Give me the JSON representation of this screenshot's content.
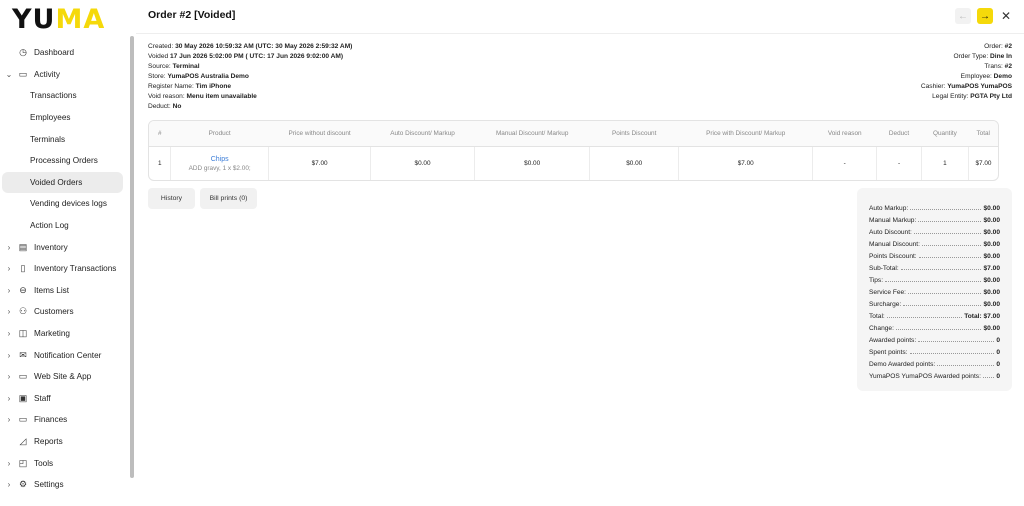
{
  "logo": {
    "main": "YU",
    "accent": "MA"
  },
  "sidebar": {
    "items": [
      {
        "label": "Dashboard",
        "icon": "dashboard-icon",
        "glyph": "◷",
        "chevron": "",
        "type": "top"
      },
      {
        "label": "Activity",
        "icon": "activity-icon",
        "glyph": "▭",
        "chevron": "⌄",
        "type": "top"
      },
      {
        "label": "Transactions",
        "type": "sub"
      },
      {
        "label": "Employees",
        "type": "sub"
      },
      {
        "label": "Terminals",
        "type": "sub"
      },
      {
        "label": "Processing Orders",
        "type": "sub"
      },
      {
        "label": "Voided Orders",
        "type": "sub-active"
      },
      {
        "label": "Vending devices logs",
        "type": "sub"
      },
      {
        "label": "Action Log",
        "type": "sub"
      },
      {
        "label": "Inventory",
        "icon": "inventory-icon",
        "glyph": "▤",
        "chevron": "›",
        "type": "top"
      },
      {
        "label": "Inventory Transactions",
        "icon": "inventory-transactions-icon",
        "glyph": "▯",
        "chevron": "›",
        "type": "top"
      },
      {
        "label": "Items List",
        "icon": "items-list-icon",
        "glyph": "⊖",
        "chevron": "›",
        "type": "top"
      },
      {
        "label": "Customers",
        "icon": "customers-icon",
        "glyph": "⚇",
        "chevron": "›",
        "type": "top"
      },
      {
        "label": "Marketing",
        "icon": "marketing-icon",
        "glyph": "◫",
        "chevron": "›",
        "type": "top"
      },
      {
        "label": "Notification Center",
        "icon": "notification-icon",
        "glyph": "✉",
        "chevron": "›",
        "type": "top"
      },
      {
        "label": "Web Site & App",
        "icon": "website-icon",
        "glyph": "▭",
        "chevron": "›",
        "type": "top"
      },
      {
        "label": "Staff",
        "icon": "staff-icon",
        "glyph": "▣",
        "chevron": "›",
        "type": "top"
      },
      {
        "label": "Finances",
        "icon": "finances-icon",
        "glyph": "▭",
        "chevron": "›",
        "type": "top"
      },
      {
        "label": "Reports",
        "icon": "reports-icon",
        "glyph": "◿",
        "chevron": "",
        "type": "top"
      },
      {
        "label": "Tools",
        "icon": "tools-icon",
        "glyph": "◰",
        "chevron": "›",
        "type": "top"
      },
      {
        "label": "Settings",
        "icon": "settings-icon",
        "glyph": "⚙",
        "chevron": "›",
        "type": "top"
      }
    ]
  },
  "header": {
    "title": "Order #2 [Voided]",
    "prev_glyph": "←",
    "next_glyph": "→",
    "close_glyph": "✕"
  },
  "info_left": [
    {
      "label": "Created: ",
      "value": "30 May 2026 10:59:32 AM (UTC: 30 May 2026 2:59:32 AM)"
    },
    {
      "label": "Voided ",
      "value": "17 Jun 2026 5:02:00 PM ( UTC: 17 Jun 2026 9:02:00 AM)"
    },
    {
      "label": "Source: ",
      "value": "Terminal"
    },
    {
      "label": "Store: ",
      "value": "YumaPOS Australia Demo"
    },
    {
      "label": "Register Name: ",
      "value": "Tim iPhone"
    },
    {
      "label": "Void reason: ",
      "value": "Menu item unavailable"
    },
    {
      "label": "Deduct: ",
      "value": "No"
    }
  ],
  "info_right": [
    {
      "label": "Order: ",
      "value": "#2"
    },
    {
      "label": "Order Type: ",
      "value": "Dine In"
    },
    {
      "label": "Trans: ",
      "value": "#2"
    },
    {
      "label": "Employee: ",
      "value": "Demo"
    },
    {
      "label": "Cashier: ",
      "value": "YumaPOS YumaPOS"
    },
    {
      "label": "Legal Entity: ",
      "value": "PGTA Pty Ltd"
    }
  ],
  "table": {
    "headers": [
      "#",
      "Product",
      "Price without discount",
      "Auto Discount/ Markup",
      "Manual Discount/ Markup",
      "Points Discount",
      "Price with Discount/ Markup",
      "Void reason",
      "Deduct",
      "Quantity",
      "Total"
    ],
    "rows": [
      {
        "num": "1",
        "product": "Chips",
        "product_sub": "ADD gravy, 1 x $2.00;",
        "price": "$7.00",
        "auto_discount": "$0.00",
        "manual_discount": "$0.00",
        "points_discount": "$0.00",
        "price_with_discount": "$7.00",
        "void_reason": "-",
        "deduct": "-",
        "quantity": "1",
        "total": "$7.00"
      }
    ]
  },
  "buttons": {
    "history": "History",
    "bill_prints": "Bill prints (0)"
  },
  "summary": [
    {
      "label": "Auto Markup:",
      "value": "$0.00"
    },
    {
      "label": "Manual Markup:",
      "value": "$0.00"
    },
    {
      "label": "Auto Discount:",
      "value": "$0.00"
    },
    {
      "label": "Manual Discount:",
      "value": "$0.00"
    },
    {
      "label": "Points Discount:",
      "value": "$0.00"
    },
    {
      "label": "Sub-Total:",
      "value": "$7.00"
    },
    {
      "label": "Tips:",
      "value": "$0.00"
    },
    {
      "label": "Service Fee:",
      "value": "$0.00"
    },
    {
      "label": "Surcharge:",
      "value": "$0.00"
    },
    {
      "label": "Total:",
      "value": "Total: $7.00"
    },
    {
      "label": "Change:",
      "value": "$0.00"
    },
    {
      "label": "Awarded points:",
      "value": "0"
    },
    {
      "label": "Spent points:",
      "value": "0"
    },
    {
      "label": "Demo Awarded points:",
      "value": "0"
    },
    {
      "label": "YumaPOS YumaPOS Awarded points:",
      "value": "0"
    }
  ],
  "colors": {
    "accent": "#f5d90a",
    "link": "#3b7dd8"
  }
}
